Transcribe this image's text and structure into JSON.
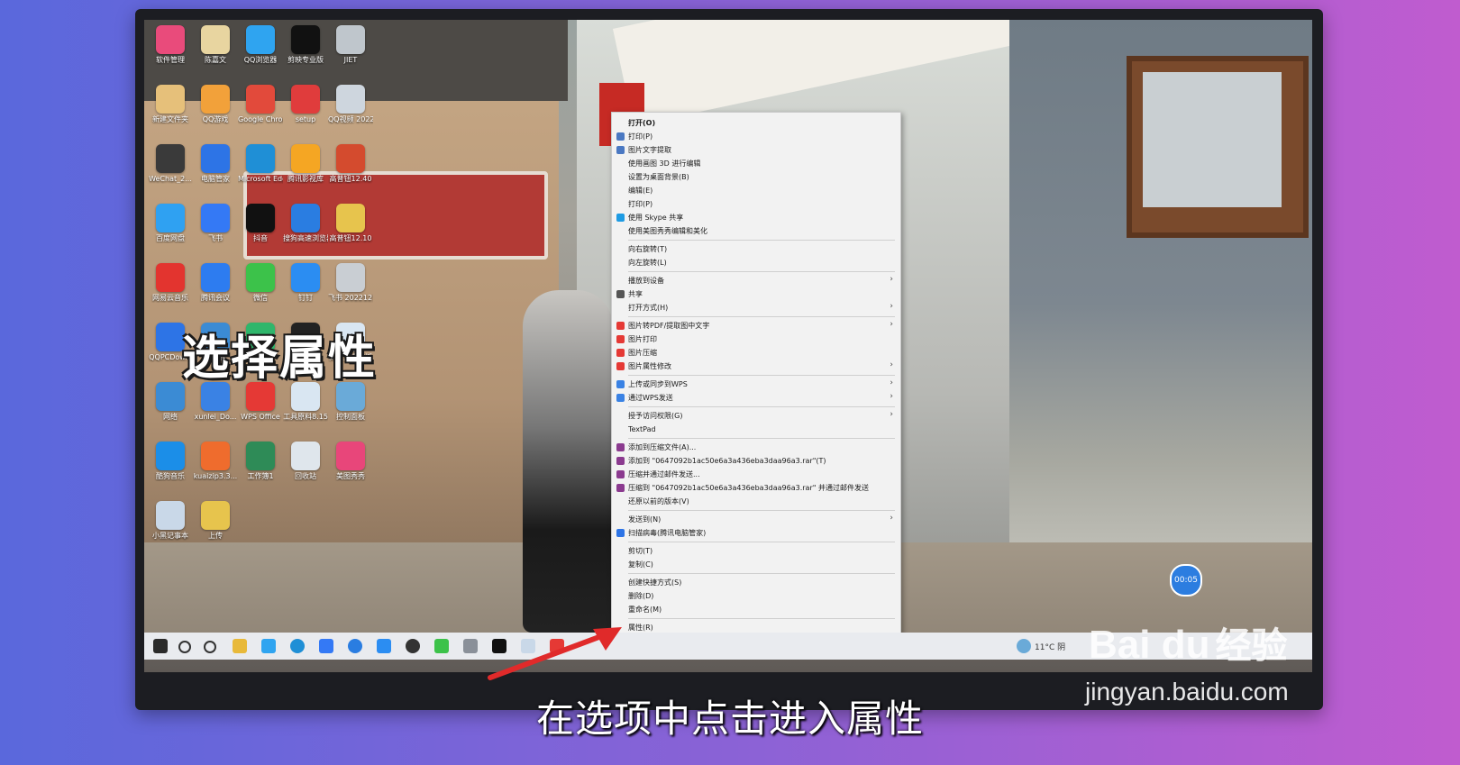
{
  "overlay_title": "选择属性",
  "caption": "在选项中点击进入属性",
  "desktop_icons": [
    {
      "label": "软件管理",
      "color": "#e94b7b"
    },
    {
      "label": "陈嘉文",
      "color": "#e8d5a0"
    },
    {
      "label": "QQ浏览器",
      "color": "#2fa4f0"
    },
    {
      "label": "剪映专业版",
      "color": "#111111"
    },
    {
      "label": "JIET",
      "color": "#bfc6cc"
    },
    {
      "label": "新建文件夹",
      "color": "#e6c07a"
    },
    {
      "label": "QQ游戏",
      "color": "#f2a13a"
    },
    {
      "label": "Google Chrome",
      "color": "#e24a3b"
    },
    {
      "label": "setup",
      "color": "#e03c3c"
    },
    {
      "label": "QQ视频 20221212...",
      "color": "#ced6de"
    },
    {
      "label": "WeChat_2...",
      "color": "#3a3a3a"
    },
    {
      "label": "电脑管家",
      "color": "#2d74e6"
    },
    {
      "label": "Microsoft Edge",
      "color": "#1f8fd6"
    },
    {
      "label": "腾讯影视库",
      "color": "#f5a623"
    },
    {
      "label": "高普钮12.40",
      "color": "#d44b2e"
    },
    {
      "label": "百度网盘",
      "color": "#2fa1f2"
    },
    {
      "label": "飞书",
      "color": "#3479f5"
    },
    {
      "label": "抖音",
      "color": "#111111"
    },
    {
      "label": "搜狗高速浏览器",
      "color": "#2a7de1"
    },
    {
      "label": "高普钮12.10",
      "color": "#e7c44d"
    },
    {
      "label": "网易云音乐",
      "color": "#e3342f"
    },
    {
      "label": "腾讯会议",
      "color": "#2d7cf0"
    },
    {
      "label": "微信",
      "color": "#3cc24a"
    },
    {
      "label": "钉钉",
      "color": "#2b8df2"
    },
    {
      "label": "飞书 20221212...",
      "color": "#c9ced3"
    },
    {
      "label": "QQPCDow...",
      "color": "#2d74e6"
    },
    {
      "label": "此电脑",
      "color": "#3b8bd4"
    },
    {
      "label": "腾讯视频",
      "color": "#2fb66b"
    },
    {
      "label": "腾讯QQ",
      "color": "#222222"
    },
    {
      "label": "简介文本模板",
      "color": "#d9e6f2"
    },
    {
      "label": "网络",
      "color": "#3b8bd4"
    },
    {
      "label": "xunlei_Do...",
      "color": "#3a82e4"
    },
    {
      "label": "WPS Office",
      "color": "#e53935"
    },
    {
      "label": "工具原料8.15",
      "color": "#d9e6f2"
    },
    {
      "label": "控制面板",
      "color": "#6aaad8"
    },
    {
      "label": "酷狗音乐",
      "color": "#1b8ee8"
    },
    {
      "label": "kuaizip3.3...",
      "color": "#ef6c2d"
    },
    {
      "label": "工作簿1",
      "color": "#2e8b57"
    },
    {
      "label": "回收站",
      "color": "#dfe6ec"
    },
    {
      "label": "美图秀秀",
      "color": "#e8467a"
    },
    {
      "label": "小黑记事本",
      "color": "#c9d8e8"
    },
    {
      "label": "上传",
      "color": "#e7c44d"
    }
  ],
  "context_menu": [
    {
      "label": "打开(O)",
      "bold": true,
      "icon": "",
      "arrow": false
    },
    {
      "label": "打印(P)",
      "icon": "print-icon",
      "arrow": false
    },
    {
      "label": "图片文字提取",
      "icon": "text-extract-icon",
      "arrow": false
    },
    {
      "label": "使用画图 3D 进行编辑",
      "icon": "",
      "arrow": false
    },
    {
      "label": "设置为桌面背景(B)",
      "icon": "",
      "arrow": false
    },
    {
      "label": "编辑(E)",
      "icon": "",
      "arrow": false
    },
    {
      "label": "打印(P)",
      "icon": "",
      "arrow": false
    },
    {
      "label": "使用 Skype 共享",
      "icon": "skype-icon",
      "arrow": false
    },
    {
      "label": "使用美图秀秀编辑和美化",
      "icon": "",
      "arrow": false
    },
    {
      "sep": true
    },
    {
      "label": "向右旋转(T)",
      "icon": "",
      "arrow": false
    },
    {
      "label": "向左旋转(L)",
      "icon": "",
      "arrow": false
    },
    {
      "sep": true
    },
    {
      "label": "播放到设备",
      "icon": "",
      "arrow": true
    },
    {
      "label": "共享",
      "icon": "share-icon",
      "arrow": false
    },
    {
      "label": "打开方式(H)",
      "icon": "",
      "arrow": true
    },
    {
      "sep": true
    },
    {
      "label": "图片转PDF/提取图中文字",
      "icon": "wps-icon",
      "arrow": true
    },
    {
      "label": "图片打印",
      "icon": "wps-icon",
      "arrow": false
    },
    {
      "label": "图片压缩",
      "icon": "wps-icon",
      "arrow": false
    },
    {
      "label": "图片属性修改",
      "icon": "wps-icon",
      "arrow": true
    },
    {
      "sep": true
    },
    {
      "label": "上传或同步到WPS",
      "icon": "cloud-icon",
      "arrow": true
    },
    {
      "label": "通过WPS发送",
      "icon": "send-icon",
      "arrow": true
    },
    {
      "sep": true
    },
    {
      "label": "授予访问权限(G)",
      "icon": "",
      "arrow": true
    },
    {
      "label": "TextPad",
      "icon": "",
      "arrow": false
    },
    {
      "sep": true
    },
    {
      "label": "添加到压缩文件(A)...",
      "icon": "winrar-icon",
      "arrow": false
    },
    {
      "label": "添加到 \"0647092b1ac50e6a3a436eba3daa96a3.rar\"(T)",
      "icon": "winrar-icon",
      "arrow": false
    },
    {
      "label": "压缩并通过邮件发送...",
      "icon": "winrar-icon",
      "arrow": false
    },
    {
      "label": "压缩到 \"0647092b1ac50e6a3a436eba3daa96a3.rar\" 并通过邮件发送",
      "icon": "winrar-icon",
      "arrow": false
    },
    {
      "label": "还原以前的版本(V)",
      "icon": "",
      "arrow": false
    },
    {
      "sep": true
    },
    {
      "label": "发送到(N)",
      "icon": "",
      "arrow": true
    },
    {
      "label": "扫描病毒(腾讯电脑管家)",
      "icon": "shield-icon",
      "arrow": false
    },
    {
      "sep": true
    },
    {
      "label": "剪切(T)",
      "icon": "",
      "arrow": false
    },
    {
      "label": "复制(C)",
      "icon": "",
      "arrow": false
    },
    {
      "sep": true
    },
    {
      "label": "创建快捷方式(S)",
      "icon": "",
      "arrow": false
    },
    {
      "label": "删除(D)",
      "icon": "",
      "arrow": false
    },
    {
      "label": "重命名(M)",
      "icon": "",
      "arrow": false
    },
    {
      "sep": true
    },
    {
      "label": "属性(R)",
      "icon": "",
      "arrow": false
    }
  ],
  "taskbar": {
    "weather": "11°C 阴",
    "clock_badge": "00:05"
  },
  "watermark": {
    "logo": "Bai du",
    "jingyan": "经验",
    "url": "jingyan.baidu.com"
  },
  "colors": {
    "menu_bg": "#f2f2f2",
    "arrow": "#e02a2a",
    "badge": "#2c7de0"
  }
}
